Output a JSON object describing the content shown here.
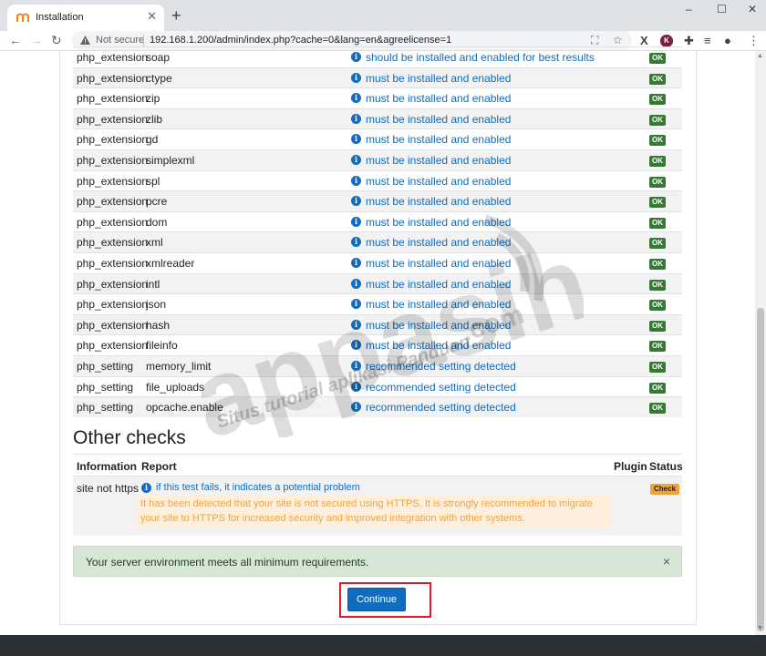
{
  "browser": {
    "tab_title": "Installation",
    "new_tab": "+",
    "not_secure": "Not secure",
    "url": "192.168.1.200/admin/index.php?cache=0&lang=en&agreelicense=1",
    "window_controls": {
      "minimize": "–",
      "maximize": "☐",
      "close": "✕"
    },
    "tab_close": "✕"
  },
  "environment_rows": [
    {
      "type": "php_extension",
      "name": "soap",
      "report": "should be installed and enabled for best results",
      "status": "OK"
    },
    {
      "type": "php_extension",
      "name": "ctype",
      "report": "must be installed and enabled",
      "status": "OK"
    },
    {
      "type": "php_extension",
      "name": "zip",
      "report": "must be installed and enabled",
      "status": "OK"
    },
    {
      "type": "php_extension",
      "name": "zlib",
      "report": "must be installed and enabled",
      "status": "OK"
    },
    {
      "type": "php_extension",
      "name": "gd",
      "report": "must be installed and enabled",
      "status": "OK"
    },
    {
      "type": "php_extension",
      "name": "simplexml",
      "report": "must be installed and enabled",
      "status": "OK"
    },
    {
      "type": "php_extension",
      "name": "spl",
      "report": "must be installed and enabled",
      "status": "OK"
    },
    {
      "type": "php_extension",
      "name": "pcre",
      "report": "must be installed and enabled",
      "status": "OK"
    },
    {
      "type": "php_extension",
      "name": "dom",
      "report": "must be installed and enabled",
      "status": "OK"
    },
    {
      "type": "php_extension",
      "name": "xml",
      "report": "must be installed and enabled",
      "status": "OK"
    },
    {
      "type": "php_extension",
      "name": "xmlreader",
      "report": "must be installed and enabled",
      "status": "OK"
    },
    {
      "type": "php_extension",
      "name": "intl",
      "report": "must be installed and enabled",
      "status": "OK"
    },
    {
      "type": "php_extension",
      "name": "json",
      "report": "must be installed and enabled",
      "status": "OK"
    },
    {
      "type": "php_extension",
      "name": "hash",
      "report": "must be installed and enabled",
      "status": "OK"
    },
    {
      "type": "php_extension",
      "name": "fileinfo",
      "report": "must be installed and enabled",
      "status": "OK"
    },
    {
      "type": "php_setting",
      "name": "memory_limit",
      "report": "recommended setting detected",
      "status": "OK"
    },
    {
      "type": "php_setting",
      "name": "file_uploads",
      "report": "recommended setting detected",
      "status": "OK"
    },
    {
      "type": "php_setting",
      "name": "opcache.enable",
      "report": "recommended setting detected",
      "status": "OK"
    }
  ],
  "other_checks": {
    "title": "Other checks",
    "headers": {
      "information": "Information",
      "report": "Report",
      "plugin": "Plugin",
      "status": "Status"
    },
    "row": {
      "information": "site not https",
      "report_link": "if this test fails, it indicates a potential problem",
      "warning": "It has been detected that your site is not secured using HTTPS. It is strongly recommended to migrate your site to HTTPS for increased security and improved integration with other systems.",
      "status": "Check"
    }
  },
  "alert": {
    "text": "Your server environment meets all minimum requirements.",
    "close": "×"
  },
  "continue_label": "Continue",
  "watermark": {
    "brand": "appasih",
    "domain": ".com",
    "tagline": "Situs tutorial aplikasi Panduan"
  },
  "colors": {
    "link": "#0f6cbf",
    "ok": "#357a32",
    "check": "#f0a33d",
    "alert_bg": "#d7e6d6",
    "highlight": "#e0182d"
  },
  "icons": {
    "info": "info-icon",
    "close": "close-icon"
  }
}
